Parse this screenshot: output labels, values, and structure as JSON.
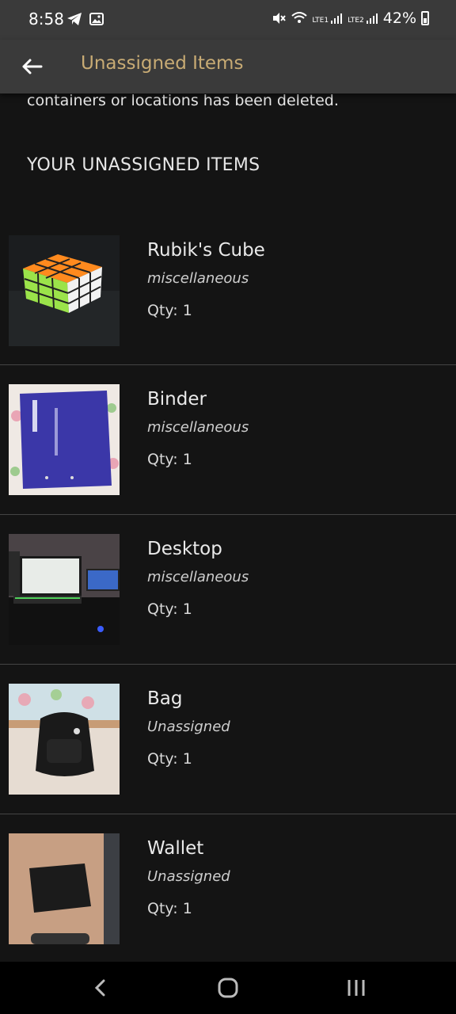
{
  "status": {
    "time": "8:58",
    "battery": "42%",
    "icons": [
      "telegram-icon",
      "image-icon",
      "mute-icon",
      "wifi-icon",
      "lte1-signal-icon",
      "lte2-signal-icon",
      "battery-icon"
    ],
    "lte1": "LTE1",
    "lte2": "LTE2"
  },
  "appbar": {
    "title": "Unassigned Items",
    "title_color": "#c8ab74"
  },
  "description": "containers or locations has been deleted.",
  "section_title": "YOUR UNASSIGNED ITEMS",
  "items": [
    {
      "name": "Rubik's Cube",
      "category": "miscellaneous",
      "qty": "Qty: 1"
    },
    {
      "name": "Binder",
      "category": "miscellaneous",
      "qty": "Qty: 1"
    },
    {
      "name": "Desktop",
      "category": "miscellaneous",
      "qty": "Qty: 1"
    },
    {
      "name": "Bag",
      "category": "Unassigned",
      "qty": "Qty: 1"
    },
    {
      "name": "Wallet",
      "category": "Unassigned",
      "qty": "Qty: 1"
    }
  ],
  "colors": {
    "background": "#141414",
    "bar": "#3a3a3a",
    "divider": "#444444"
  }
}
